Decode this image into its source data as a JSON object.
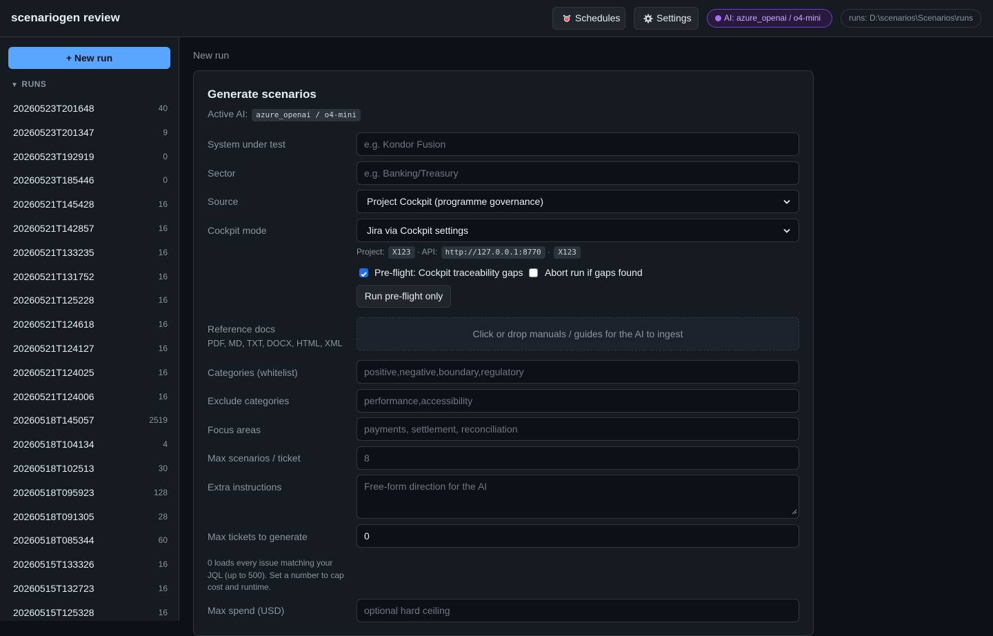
{
  "app": {
    "title": "scenariogen review",
    "schedules_label": "Schedules",
    "settings_label": "Settings",
    "ai_badge": "AI: azure_openai / o4-mini",
    "runs_path": "runs: D:\\scenarios\\Scenarios\\runs"
  },
  "sidebar": {
    "new_run_label": "+ New run",
    "runs_header": "RUNS",
    "runs": [
      {
        "id": "20260523T201648",
        "count": "40"
      },
      {
        "id": "20260523T201347",
        "count": "9"
      },
      {
        "id": "20260523T192919",
        "count": "0"
      },
      {
        "id": "20260523T185446",
        "count": "0"
      },
      {
        "id": "20260521T145428",
        "count": "16"
      },
      {
        "id": "20260521T142857",
        "count": "16"
      },
      {
        "id": "20260521T133235",
        "count": "16"
      },
      {
        "id": "20260521T131752",
        "count": "16"
      },
      {
        "id": "20260521T125228",
        "count": "16"
      },
      {
        "id": "20260521T124618",
        "count": "16"
      },
      {
        "id": "20260521T124127",
        "count": "16"
      },
      {
        "id": "20260521T124025",
        "count": "16"
      },
      {
        "id": "20260521T124006",
        "count": "16"
      },
      {
        "id": "20260518T145057",
        "count": "2519"
      },
      {
        "id": "20260518T104134",
        "count": "4"
      },
      {
        "id": "20260518T102513",
        "count": "30"
      },
      {
        "id": "20260518T095923",
        "count": "128"
      },
      {
        "id": "20260518T091305",
        "count": "28"
      },
      {
        "id": "20260518T085344",
        "count": "60"
      },
      {
        "id": "20260515T133326",
        "count": "16"
      },
      {
        "id": "20260515T132723",
        "count": "16"
      },
      {
        "id": "20260515T125328",
        "count": "16"
      }
    ]
  },
  "main": {
    "breadcrumb": "New run",
    "title": "Generate scenarios",
    "active_ai_label": "Active AI:",
    "active_ai_value": "azure_openai / o4-mini",
    "fields": {
      "system": {
        "label": "System under test",
        "placeholder": "e.g. Kondor Fusion"
      },
      "sector": {
        "label": "Sector",
        "placeholder": "e.g. Banking/Treasury"
      },
      "source": {
        "label": "Source",
        "value": "Project Cockpit (programme governance)"
      },
      "cockpit_mode": {
        "label": "Cockpit mode",
        "value": "Jira via Cockpit settings"
      },
      "reference_docs": {
        "label": "Reference docs",
        "sub": "PDF, MD, TXT, DOCX, HTML, XML",
        "drop_text": "Click or drop manuals / guides for the AI to ingest"
      },
      "categories": {
        "label": "Categories (whitelist)",
        "placeholder": "positive,negative,boundary,regulatory"
      },
      "exclude": {
        "label": "Exclude categories",
        "placeholder": "performance,accessibility"
      },
      "focus": {
        "label": "Focus areas",
        "placeholder": "payments, settlement, reconciliation"
      },
      "max_scenarios": {
        "label": "Max scenarios / ticket",
        "placeholder": "8"
      },
      "extra": {
        "label": "Extra instructions",
        "placeholder": "Free-form direction for the AI"
      },
      "max_tickets": {
        "label": "Max tickets to generate",
        "value": "0",
        "note": "0 loads every issue matching your JQL (up to 500). Set a number to cap cost and runtime."
      },
      "max_spend": {
        "label": "Max spend (USD)",
        "placeholder": "optional hard ceiling"
      }
    },
    "cockpit_info": {
      "project_label": "Project:",
      "project_value": "X123",
      "api_label": "· API:",
      "api_value": "http://127.0.0.1:8770",
      "sep": "·",
      "api_project": "X123"
    },
    "preflight": {
      "label": "Pre-flight: Cockpit traceability gaps",
      "checked": true
    },
    "abort": {
      "label": "Abort run if gaps found",
      "checked": false
    },
    "preflight_button": "Run pre-flight only"
  }
}
